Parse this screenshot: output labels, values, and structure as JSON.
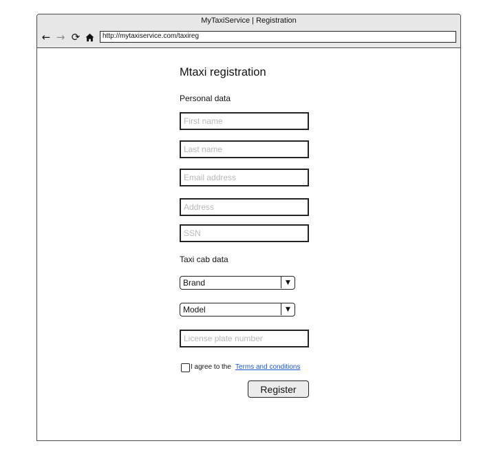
{
  "window": {
    "title": "MyTaxiService | Registration"
  },
  "browser": {
    "url": "http://mytaxiservice.com/taxireg",
    "icons": {
      "back": "left-arrow-icon",
      "forward": "right-arrow-icon",
      "reload": "reload-icon",
      "home": "home-icon"
    }
  },
  "form": {
    "heading": "Mtaxi registration",
    "personal_section": "Personal data",
    "first_name_placeholder": "First name",
    "last_name_placeholder": "Last name",
    "email_placeholder": "Email address",
    "address_placeholder": "Address",
    "ssn_placeholder": "SSN",
    "taxi_section": "Taxi cab data",
    "brand_select": "Brand",
    "model_select": "Model",
    "license_placeholder": "License plate number",
    "agree_text": "I agree to the",
    "terms_link": "Terms and conditions",
    "register_button": "Register"
  },
  "colors": {
    "link": "#1a57c9",
    "placeholder": "#b7b7b7",
    "chrome": "#e7e7e7"
  }
}
